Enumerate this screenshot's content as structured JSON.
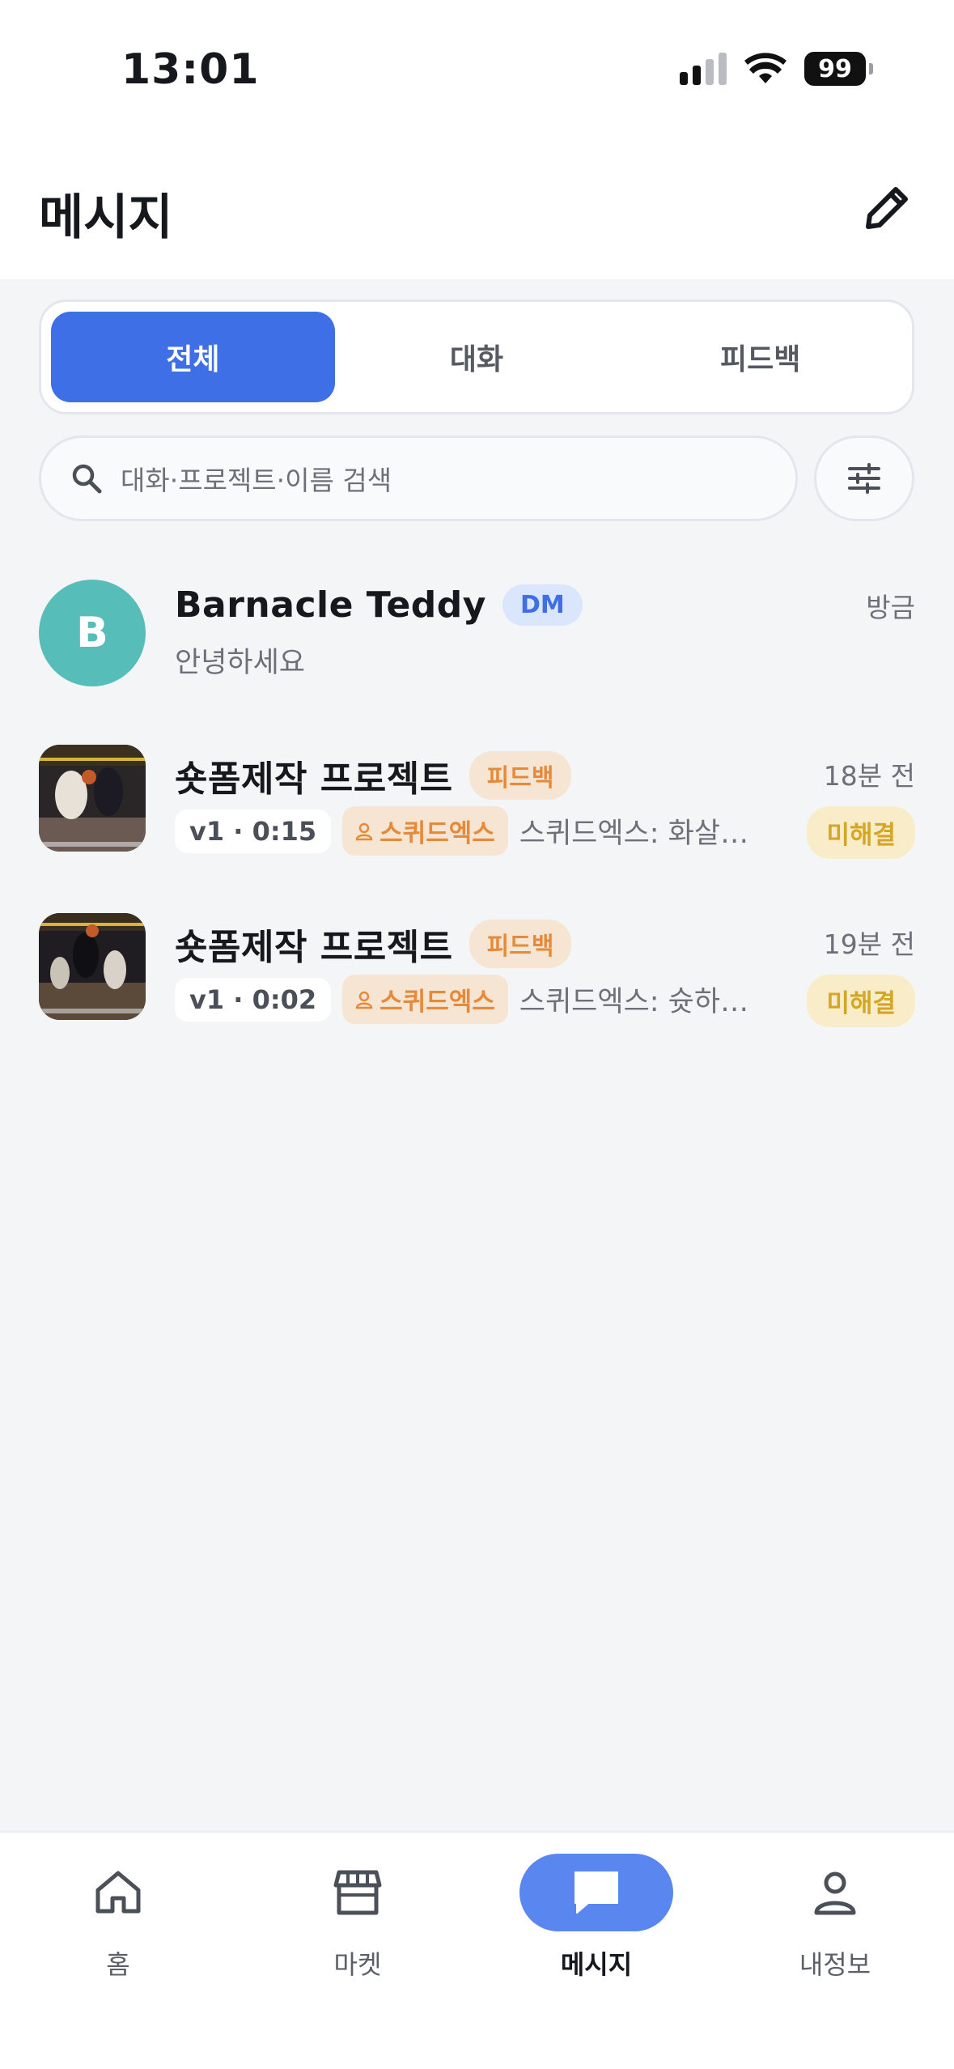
{
  "status_bar": {
    "time": "13:01",
    "battery": "99"
  },
  "header": {
    "title": "메시지"
  },
  "tabs": [
    {
      "label": "전체",
      "active": true
    },
    {
      "label": "대화",
      "active": false
    },
    {
      "label": "피드백",
      "active": false
    }
  ],
  "search": {
    "placeholder": "대화·프로젝트·이름 검색"
  },
  "conversations": [
    {
      "avatar_letter": "B",
      "name": "Barnacle Teddy",
      "badge": "DM",
      "time": "방금",
      "preview": "안녕하세요"
    },
    {
      "name": "숏폼제작 프로젝트",
      "badge": "피드백",
      "time": "18분 전",
      "version": "v1 · 0:15",
      "user": "스퀴드엑스",
      "preview": "스퀴드엑스: 화살…",
      "status": "미해결"
    },
    {
      "name": "숏폼제작 프로젝트",
      "badge": "피드백",
      "time": "19분 전",
      "version": "v1 · 0:02",
      "user": "스퀴드엑스",
      "preview": "스퀴드엑스: 슛하…",
      "status": "미해결"
    }
  ],
  "bottom_nav": [
    {
      "label": "홈",
      "icon": "home-icon"
    },
    {
      "label": "마켓",
      "icon": "store-icon"
    },
    {
      "label": "메시지",
      "icon": "chat-icon",
      "active": true
    },
    {
      "label": "내정보",
      "icon": "user-icon"
    }
  ],
  "colors": {
    "accent": "#3f6fe6",
    "avatar_teal": "#56bdb9",
    "feedback_orange": "#e58a3a",
    "unresolved_yellow": "#d4a626"
  }
}
